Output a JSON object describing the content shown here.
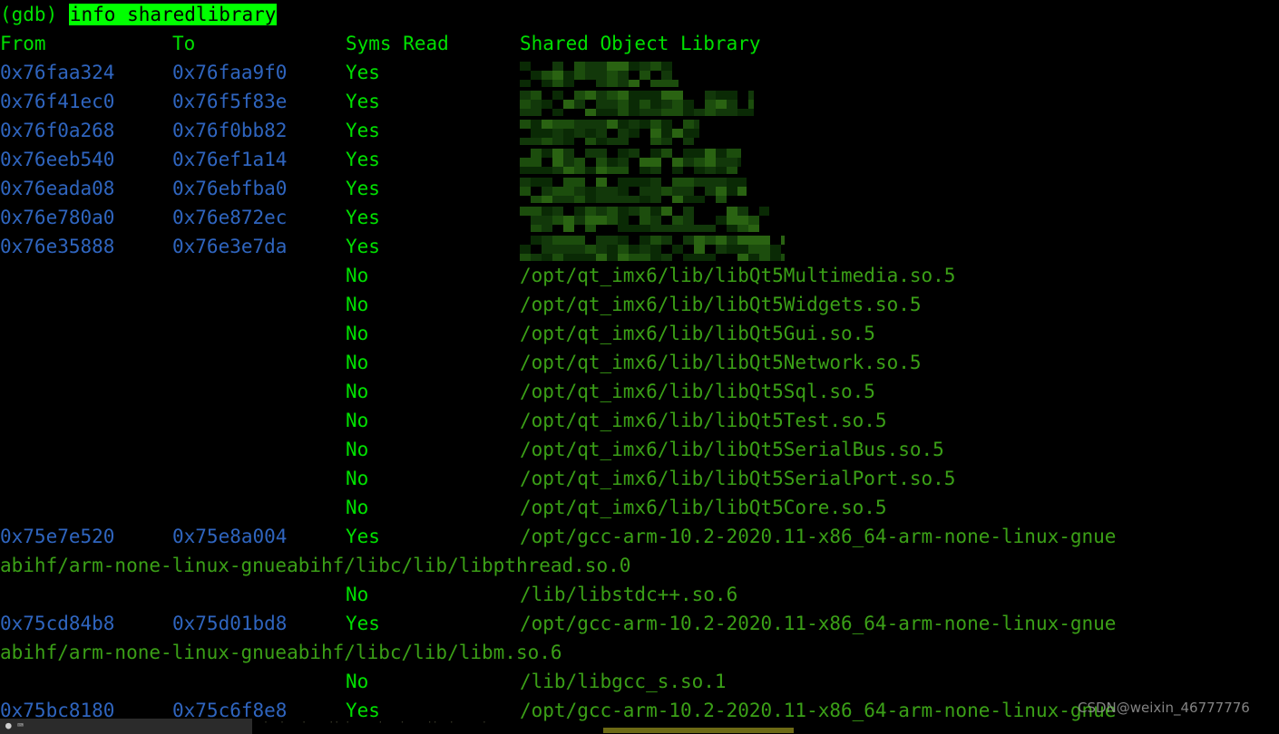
{
  "terminal": {
    "prompt": "(gdb) ",
    "command": "info sharedlibrary",
    "colors": {
      "background": "#000000",
      "bright_green": "#00e000",
      "highlight_bg": "#00ff00",
      "highlight_fg": "#000000",
      "address_blue": "#2f65bf",
      "path_green": "#3ba017",
      "redaction_green": "#14400a",
      "taskbar": "#2b2b2b",
      "olive_bar": "#6d6a15"
    }
  },
  "header": {
    "from": "From",
    "to": "To",
    "syms_read": "Syms Read",
    "shared_object_library": "Shared Object Library"
  },
  "rows": [
    {
      "from": "0x76faa324",
      "to": "0x76faa9f0",
      "syms": "Yes",
      "library": "",
      "redacted": true,
      "redact_width": 175,
      "ghost": "lib"
    },
    {
      "from": "0x76f41ec0",
      "to": "0x76f5f83e",
      "syms": "Yes",
      "library": "",
      "redacted": true,
      "redact_width": 258,
      "ghost": "lib"
    },
    {
      "from": "0x76f0a268",
      "to": "0x76f0bb82",
      "syms": "Yes",
      "library": "",
      "redacted": true,
      "redact_width": 198,
      "ghost": "lib"
    },
    {
      "from": "0x76eeb540",
      "to": "0x76ef1a14",
      "syms": "Yes",
      "library": "",
      "redacted": true,
      "redact_width": 244,
      "ghost": "lib"
    },
    {
      "from": "0x76eada08",
      "to": "0x76ebfba0",
      "syms": "Yes",
      "library": "",
      "redacted": true,
      "redact_width": 250,
      "ghost": "libr"
    },
    {
      "from": "0x76e780a0",
      "to": "0x76e872ec",
      "syms": "Yes",
      "library": "",
      "redacted": true,
      "redact_width": 275,
      "ghost": "libT"
    },
    {
      "from": "0x76e35888",
      "to": "0x76e3e7da",
      "syms": "Yes",
      "library": "",
      "redacted": true,
      "redact_width": 292,
      "ghost": "lib"
    },
    {
      "from": "",
      "to": "",
      "syms": "No",
      "library": "/opt/qt_imx6/lib/libQt5Multimedia.so.5",
      "redacted": false
    },
    {
      "from": "",
      "to": "",
      "syms": "No",
      "library": "/opt/qt_imx6/lib/libQt5Widgets.so.5",
      "redacted": false
    },
    {
      "from": "",
      "to": "",
      "syms": "No",
      "library": "/opt/qt_imx6/lib/libQt5Gui.so.5",
      "redacted": false
    },
    {
      "from": "",
      "to": "",
      "syms": "No",
      "library": "/opt/qt_imx6/lib/libQt5Network.so.5",
      "redacted": false
    },
    {
      "from": "",
      "to": "",
      "syms": "No",
      "library": "/opt/qt_imx6/lib/libQt5Sql.so.5",
      "redacted": false
    },
    {
      "from": "",
      "to": "",
      "syms": "No",
      "library": "/opt/qt_imx6/lib/libQt5Test.so.5",
      "redacted": false
    },
    {
      "from": "",
      "to": "",
      "syms": "No",
      "library": "/opt/qt_imx6/lib/libQt5SerialBus.so.5",
      "redacted": false
    },
    {
      "from": "",
      "to": "",
      "syms": "No",
      "library": "/opt/qt_imx6/lib/libQt5SerialPort.so.5",
      "redacted": false
    },
    {
      "from": "",
      "to": "",
      "syms": "No",
      "library": "/opt/qt_imx6/lib/libQt5Core.so.5",
      "redacted": false
    },
    {
      "from": "0x75e7e520",
      "to": "0x75e8a004",
      "syms": "Yes",
      "library": "/opt/gcc-arm-10.2-2020.11-x86_64-arm-none-linux-gnue",
      "wrap": "abihf/arm-none-linux-gnueabihf/libc/lib/libpthread.so.0",
      "redacted": false
    },
    {
      "from": "",
      "to": "",
      "syms": "No",
      "library": "/lib/libstdc++.so.6",
      "redacted": false
    },
    {
      "from": "0x75cd84b8",
      "to": "0x75d01bd8",
      "syms": "Yes",
      "library": "/opt/gcc-arm-10.2-2020.11-x86_64-arm-none-linux-gnue",
      "wrap": "abihf/arm-none-linux-gnueabihf/libc/lib/libm.so.6",
      "redacted": false
    },
    {
      "from": "",
      "to": "",
      "syms": "No",
      "library": "/lib/libgcc_s.so.1",
      "redacted": false
    },
    {
      "from": "0x75bc8180",
      "to": "0x75c6f8e8",
      "syms": "Yes",
      "library": "/opt/gcc-arm-10.2-2020.11-x86_64-arm-none-linux-gnue",
      "redacted": false
    }
  ],
  "watermark": {
    "text": "CSDN@weixin_46777776"
  },
  "taskbar": {
    "glyphs": "● ⌨"
  }
}
